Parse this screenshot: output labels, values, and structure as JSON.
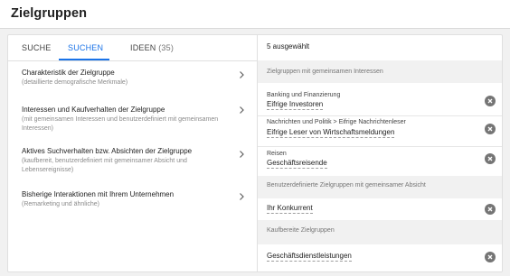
{
  "header": {
    "title": "Zielgruppen"
  },
  "tabs": [
    {
      "label": "SUCHE",
      "count": ""
    },
    {
      "label": "SUCHEN",
      "count": ""
    },
    {
      "label": "IDEEN",
      "count": "(35)"
    }
  ],
  "categories": [
    {
      "title": "Charakteristik der Zielgruppe",
      "subtitle": "(detaillierte demografische Merkmale)"
    },
    {
      "title": "Interessen und Kaufverhalten der Zielgruppe",
      "subtitle": "(mit gemeinsamen Interessen und benutzerdefiniert mit gemeinsamen Interessen)"
    },
    {
      "title": "Aktives Suchverhalten bzw. Absichten der Zielgruppe",
      "subtitle": "(kaufbereit, benutzerdefiniert mit gemeinsamer Absicht und Lebensereignisse)"
    },
    {
      "title": "Bisherige Interaktionen mit Ihrem Unternehmen",
      "subtitle": "(Remarketing und ähnliche)"
    }
  ],
  "selected": {
    "count_label": "5 ausgewählt",
    "sections": [
      {
        "label": "Zielgruppen mit gemeinsamen Interessen",
        "items": [
          {
            "path": "Banking und Finanzierung",
            "name": "Eifrige Investoren"
          },
          {
            "path": "Nachrichten und Politik > Eifrige Nachrichtenleser",
            "name": "Eifrige Leser von Wirtschaftsmeldungen"
          },
          {
            "path": "Reisen",
            "name": "Geschäftsreisende"
          }
        ]
      },
      {
        "label": "Benutzerdefinierte Zielgruppen mit gemeinsamer Absicht",
        "items": [
          {
            "path": "",
            "name": "Ihr Konkurrent"
          }
        ]
      },
      {
        "label": "Kaufbereite Zielgruppen",
        "items": [
          {
            "path": "",
            "name": "Geschäftsdienstleistungen"
          }
        ]
      }
    ]
  },
  "colors": {
    "accent": "#1a73e8",
    "remove_icon": "#757575",
    "section_bg": "#f1f1f1"
  },
  "icons": {
    "category_arrow": "chevron-right-icon",
    "remove": "remove-circle-icon"
  }
}
